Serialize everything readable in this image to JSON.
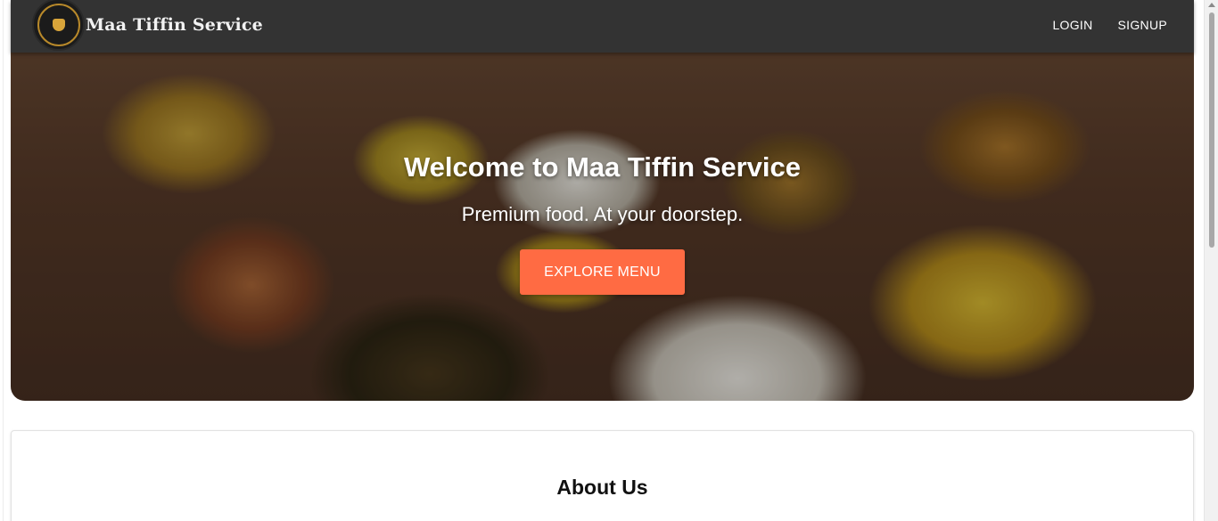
{
  "brand": {
    "name": "Maa Tiffin Service",
    "logo_text": "MAA TIFFIN SERVICE"
  },
  "nav": {
    "login_label": "LOGIN",
    "signup_label": "SIGNUP"
  },
  "hero": {
    "title": "Welcome to Maa Tiffin Service",
    "subtitle": "Premium food. At your doorstep.",
    "cta_label": "EXPLORE MENU"
  },
  "about": {
    "title": "About Us"
  },
  "colors": {
    "navbar": "#333333",
    "accent": "#ff6b43",
    "page_bg": "#ffffff"
  },
  "icons": {
    "logo": "tiffin-pot-emblem"
  }
}
